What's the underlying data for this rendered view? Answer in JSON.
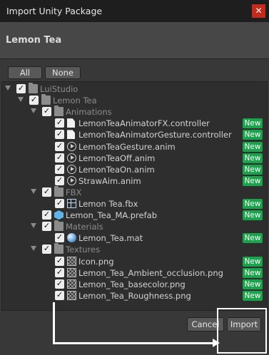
{
  "window": {
    "title": "Import Unity Package",
    "close_icon": "close-icon"
  },
  "package": {
    "name": "Lemon Tea"
  },
  "buttons": {
    "all": "All",
    "none": "None",
    "cancel": "Cancel",
    "import": "Import"
  },
  "badge_text": "New",
  "tree": [
    {
      "label": "LuiStudio",
      "depth": 0,
      "type": "folder",
      "expanded": true,
      "dim": true,
      "is_new": false
    },
    {
      "label": "Lemon Tea",
      "depth": 1,
      "type": "folder",
      "expanded": true,
      "dim": true,
      "is_new": false
    },
    {
      "label": "Animations",
      "depth": 2,
      "type": "folder",
      "expanded": true,
      "dim": true,
      "is_new": false
    },
    {
      "label": "LemonTeaAnimatorFX.controller",
      "depth": 3,
      "type": "file",
      "is_new": true
    },
    {
      "label": "LemonTeaAnimatorGesture.controller",
      "depth": 3,
      "type": "file",
      "is_new": true
    },
    {
      "label": "LemonTeaGesture.anim",
      "depth": 3,
      "type": "anim",
      "is_new": true
    },
    {
      "label": "LemonTeaOff.anim",
      "depth": 3,
      "type": "anim",
      "is_new": true
    },
    {
      "label": "LemonTeaOn.anim",
      "depth": 3,
      "type": "anim",
      "is_new": true
    },
    {
      "label": "StrawAim.anim",
      "depth": 3,
      "type": "anim",
      "is_new": true
    },
    {
      "label": "FBX",
      "depth": 2,
      "type": "folder",
      "expanded": true,
      "dim": true,
      "is_new": false
    },
    {
      "label": "Lemon Tea.fbx",
      "depth": 3,
      "type": "fbx",
      "is_new": true
    },
    {
      "label": "Lemon_Tea_MA.prefab",
      "depth": 2,
      "type": "prefab",
      "is_new": true
    },
    {
      "label": "Materials",
      "depth": 2,
      "type": "folder",
      "expanded": true,
      "dim": true,
      "is_new": false
    },
    {
      "label": "Lemon_Tea.mat",
      "depth": 3,
      "type": "mat",
      "is_new": true
    },
    {
      "label": "Textures",
      "depth": 2,
      "type": "folder",
      "expanded": true,
      "dim": true,
      "is_new": false
    },
    {
      "label": "Icon.png",
      "depth": 3,
      "type": "tex",
      "is_new": true
    },
    {
      "label": "Lemon_Tea_Ambient_occlusion.png",
      "depth": 3,
      "type": "tex",
      "is_new": true
    },
    {
      "label": "Lemon_Tea_basecolor.png",
      "depth": 3,
      "type": "tex",
      "is_new": true
    },
    {
      "label": "Lemon_Tea_Roughness.png",
      "depth": 3,
      "type": "tex",
      "is_new": true
    }
  ],
  "colors": {
    "new_badge": "#1aa34a",
    "close_button": "#c42b1c",
    "annotation": "#ffffff"
  }
}
